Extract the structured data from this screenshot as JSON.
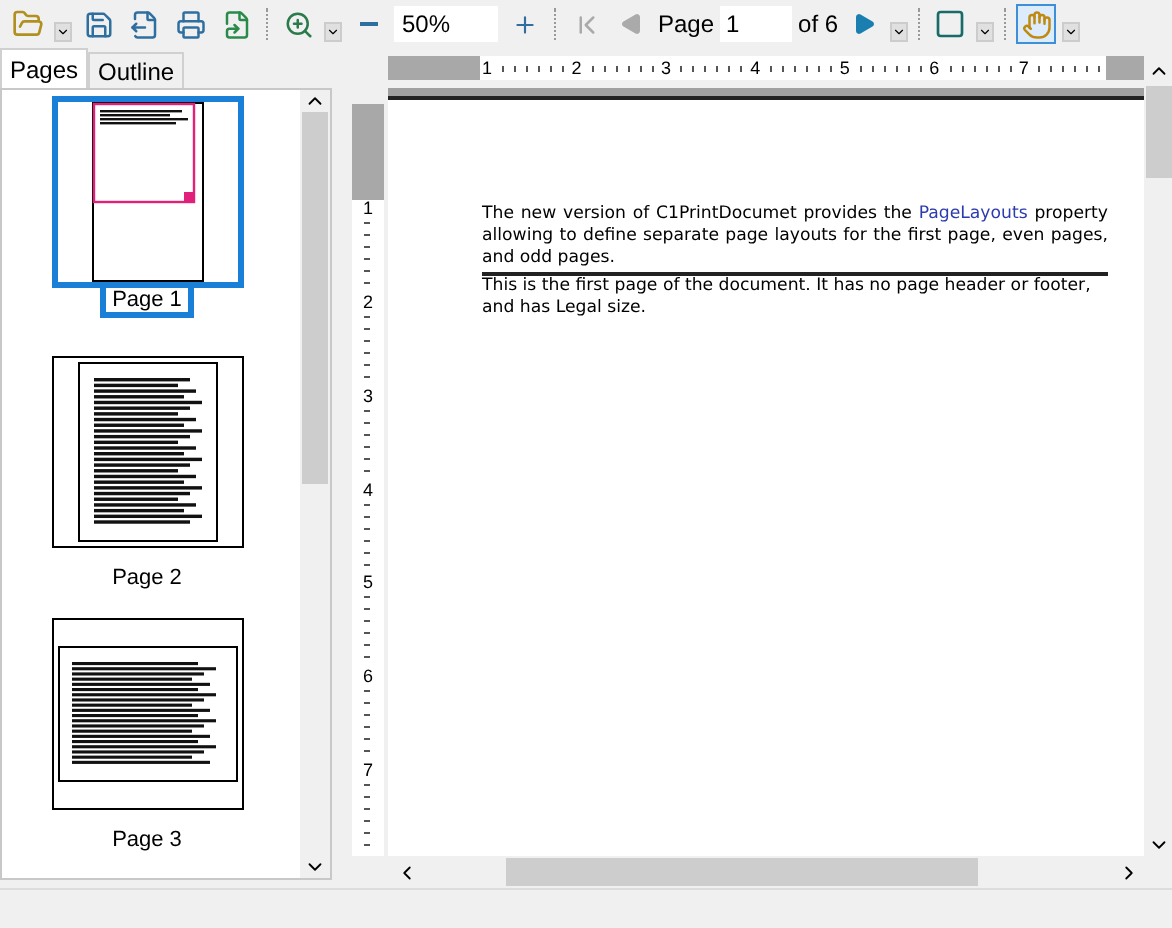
{
  "toolbar": {
    "zoom": "50%",
    "page_label": "Page",
    "page_value": "1",
    "page_count": "of 6",
    "hand_tool_selected": true
  },
  "side_tabs": [
    {
      "label": "Pages",
      "selected": true
    },
    {
      "label": "Outline",
      "selected": false
    }
  ],
  "thumbnails": [
    {
      "label": "Page 1",
      "selected": true,
      "kind": "portrait"
    },
    {
      "label": "Page 2",
      "selected": false,
      "kind": "dense"
    },
    {
      "label": "Page 3",
      "selected": false,
      "kind": "landscape"
    }
  ],
  "rulers": {
    "horizontal": [
      "1",
      "2",
      "3",
      "4",
      "5",
      "6",
      "7"
    ],
    "vertical": [
      "1",
      "2",
      "3",
      "4",
      "5",
      "6",
      "7"
    ]
  },
  "document": {
    "intro_before": "The new version of C1PrintDocumet provides the",
    "intro_link": "PageLayouts",
    "intro_after": "property allowing to define separate page layouts for the first page, even pages, and odd pages.",
    "body": "This is the first page of the document. It has no page header or footer, and has Legal size."
  }
}
